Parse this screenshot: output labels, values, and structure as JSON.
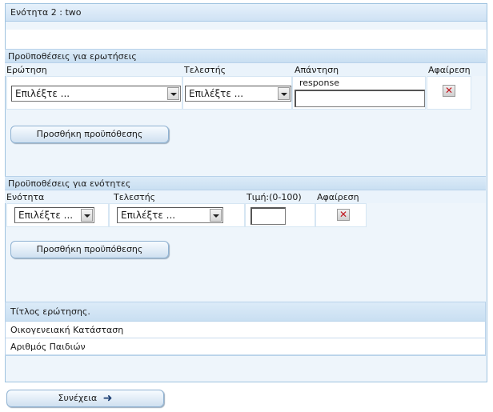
{
  "section_title": "Ενότητα 2 : two",
  "question_conditions": {
    "header": "Προϋποθέσεις για ερωτήσεις",
    "columns": [
      "Ερώτηση",
      "Τελεστής",
      "Απάντηση",
      "Αφαίρεση"
    ],
    "row": {
      "question_select": "Επιλέξτε ...",
      "operator_select": "Επιλέξτε ...",
      "answer_label": "response",
      "answer_value": ""
    },
    "add_button": "Προσθήκη προϋπόθεσης"
  },
  "section_conditions": {
    "header": "Προϋποθέσεις για ενότητες",
    "columns": [
      "Ενότητα",
      "Τελεστής",
      "Τιμή:(0-100)",
      "Αφαίρεση"
    ],
    "row": {
      "section_select": "Επιλέξτε ...",
      "operator_select": "Επιλέξτε ...",
      "value": ""
    },
    "add_button": "Προσθήκη προϋπόθεσης"
  },
  "questions_table": {
    "header": "Τίτλος ερώτησης.",
    "rows": [
      "Οικογενειακή Κατάσταση",
      "Αριθμός Παιδιών"
    ]
  },
  "continue_button": "Συνέχεια",
  "icons": {
    "delete": "delete-x-icon",
    "continue": "arrow-right-icon"
  },
  "colors": {
    "panel_bg": "#eef5fb",
    "header_bg": "#cfe2f4",
    "delete_red": "#c0141c",
    "arrow_blue": "#1d3f73"
  }
}
